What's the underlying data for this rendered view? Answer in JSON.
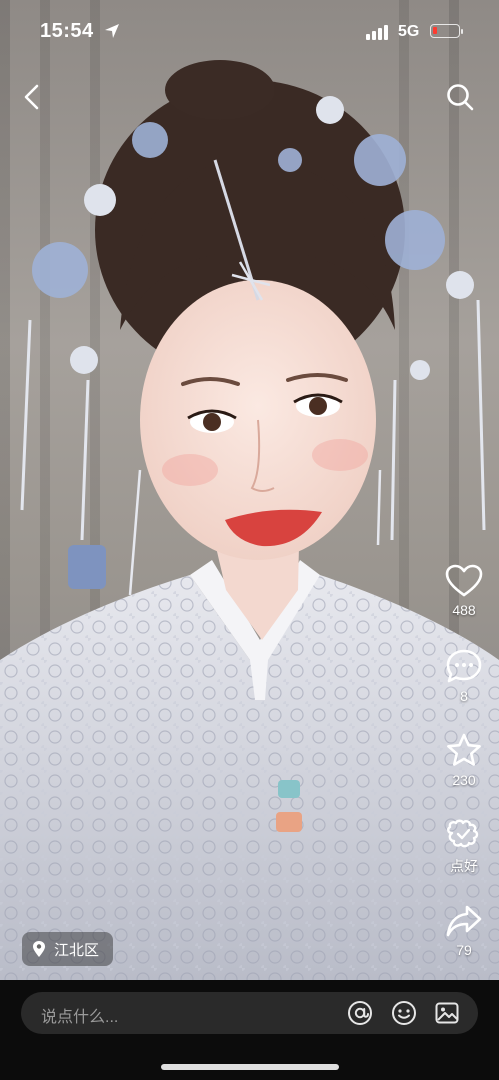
{
  "status_bar": {
    "time": "15:54",
    "network": "5G"
  },
  "header": {
    "back_icon": "chevron-left-icon",
    "search_icon": "search-icon"
  },
  "actions": {
    "like": {
      "icon": "heart-icon",
      "count": "488"
    },
    "comment": {
      "icon": "comment-icon",
      "count": "8"
    },
    "favorite": {
      "icon": "star-icon",
      "count": "230"
    },
    "recommend": {
      "icon": "recommend-icon",
      "label": "点好"
    },
    "share": {
      "icon": "share-icon",
      "count": "79"
    }
  },
  "location": {
    "icon": "location-pin-icon",
    "label": "江北区"
  },
  "comment_bar": {
    "placeholder": "说点什么...",
    "mention_icon": "at-icon",
    "emoji_icon": "smiley-icon",
    "image_icon": "image-icon"
  },
  "colors": {
    "battery_low": "#ff3b30",
    "input_bg": "#2a2a2a",
    "bottom_bg": "#0c0c0c"
  }
}
